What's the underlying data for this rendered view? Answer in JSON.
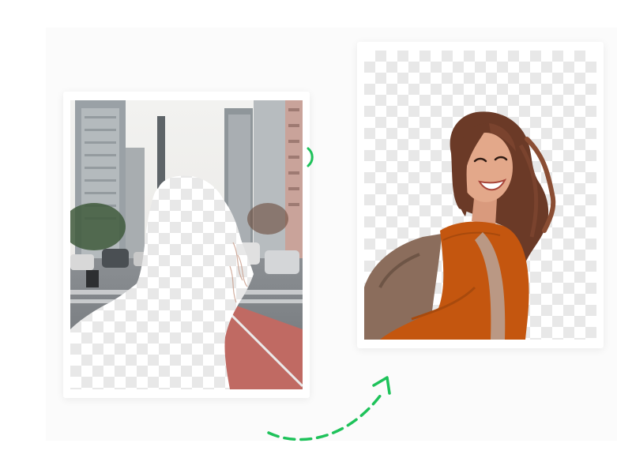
{
  "scene": {
    "accent_color": "#1ec25a",
    "checker_color": "#e8e8e8",
    "arrow_icon": "dashed-curved-arrow",
    "before_image": "street-scene-with-person-cutout",
    "after_image": "smiling-woman-transparent-background"
  },
  "colors": {
    "panel_bg": "#fbfbfb",
    "road": "#c06a63",
    "sweater": "#c4560f",
    "hair": "#6b3a27",
    "skin": "#e3a88a"
  }
}
